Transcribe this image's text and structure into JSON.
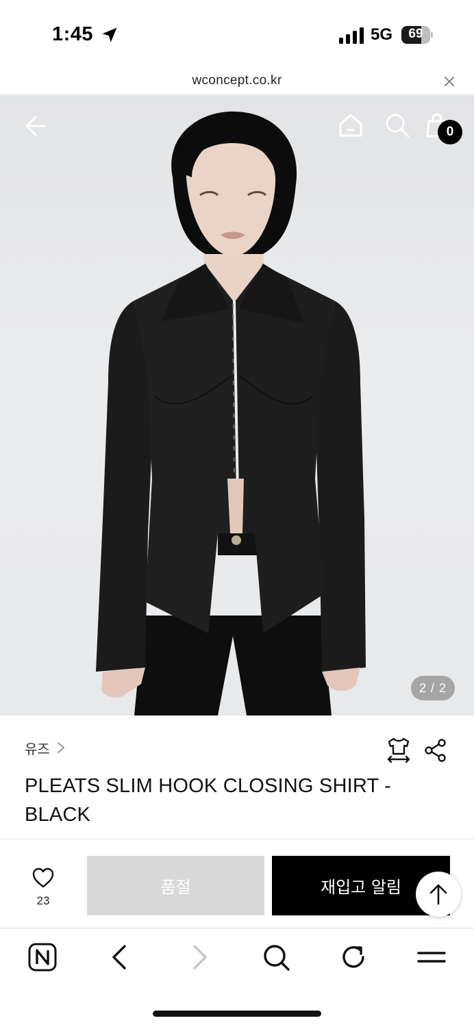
{
  "status_bar": {
    "time": "1:45",
    "network": "5G",
    "battery_level": "69",
    "battery_fraction": 0.69
  },
  "browser": {
    "url": "wconcept.co.kr"
  },
  "hero": {
    "page_counter": "2 / 2",
    "cart_count": "0",
    "icons": [
      "back-arrow-icon",
      "home-icon",
      "search-icon",
      "shopping-bag-icon"
    ]
  },
  "product": {
    "brand": "유즈",
    "title": "PLEATS SLIM HOOK CLOSING SHIRT - BLACK",
    "icons": [
      "size-guide-icon",
      "share-icon"
    ]
  },
  "actions": {
    "like_count": "23",
    "soldout_label": "품절",
    "restock_label": "재입고 알림"
  },
  "toolbar": {
    "icons": [
      "naver-icon",
      "back-icon",
      "forward-icon",
      "search-icon",
      "refresh-icon",
      "menu-icon"
    ]
  },
  "colors": {
    "accent": "#000000",
    "soldout_bg": "#d8d8d8",
    "hero_bg": "#e8e9eb"
  }
}
